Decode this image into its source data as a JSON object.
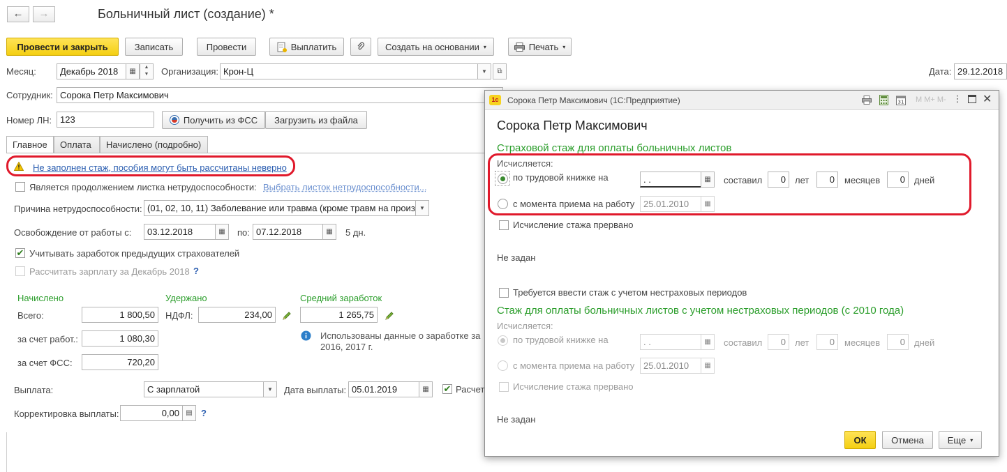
{
  "header": {
    "back_icon": "arrow-left-icon",
    "forward_icon": "arrow-right-icon",
    "title": "Больничный лист (создание) *"
  },
  "toolbar": {
    "post_close": "Провести и закрыть",
    "save": "Записать",
    "post": "Провести",
    "pay": "Выплатить",
    "create_based": "Создать на основании",
    "print": "Печать"
  },
  "form": {
    "month_label": "Месяц:",
    "month_value": "Декабрь 2018",
    "org_label": "Организация:",
    "org_value": "Крон-Ц",
    "date_label": "Дата:",
    "date_value": "29.12.2018",
    "employee_label": "Сотрудник:",
    "employee_value": "Сорока Петр Максимович",
    "ln_label": "Номер ЛН:",
    "ln_value": "123",
    "get_fss": "Получить из ФСС",
    "load_file": "Загрузить из файла",
    "tabs": [
      "Главное",
      "Оплата",
      "Начислено (подробно)"
    ],
    "warning": "Не заполнен стаж, пособия могут быть рассчитаны неверно",
    "continuation_label": "Является продолжением листка нетрудоспособности:",
    "continuation_link": "Выбрать листок нетрудоспособности...",
    "reason_label": "Причина нетрудоспособности:",
    "reason_value": "(01, 02, 10, 11) Заболевание или травма (кроме травм на произв",
    "release_label": "Освобождение от работы с:",
    "release_from": "03.12.2018",
    "release_to_label": "по:",
    "release_to": "07.12.2018",
    "release_days": "5 дн.",
    "prev_insurers_label": "Учитывать заработок предыдущих страхователей",
    "calc_salary_label": "Рассчитать зарплату за Декабрь 2018",
    "help": "?",
    "accrued_header": "Начислено",
    "withheld_header": "Удержано",
    "avg_header": "Средний заработок",
    "total_label": "Всего:",
    "total_value": "1 800,50",
    "ndfl_label": "НДФЛ:",
    "ndfl_value": "234,00",
    "avg_value": "1 265,75",
    "employer_label": "за счет работ.:",
    "employer_value": "1 080,30",
    "fss_label": "за счет ФСС:",
    "fss_value": "720,20",
    "info_text_1": "Использованы данные о заработке за",
    "info_text_2": "2016,  2017 г.",
    "payment_label": "Выплата:",
    "payment_value": "С зарплатой",
    "pay_date_label": "Дата выплаты:",
    "pay_date_value": "05.01.2019",
    "calc_cut": "Расчет",
    "correction_label": "Корректировка выплаты:",
    "correction_value": "0,00"
  },
  "dialog": {
    "app_icon": "1c-logo-icon",
    "window_title": "Сорока Петр Максимович  (1С:Предприятие)",
    "heading": "Сорока Петр Максимович",
    "section1_title": "Страховой стаж для оплаты больничных листов",
    "computed_label": "Исчисляется:",
    "by_book_label": "по трудовой книжке на",
    "by_book_date": " .  .",
    "amounted_label": "составил",
    "years_value": "0",
    "years_label": "лет",
    "months_value": "0",
    "months_label": "месяцев",
    "days_value": "0",
    "days_label": "дней",
    "from_hire_label": "с момента приема на работу",
    "from_hire_date": "25.01.2010",
    "interrupted_label": "Исчисление стажа прервано",
    "not_set": "Не задан",
    "noninsurance_label": "Требуется ввести стаж с учетом нестраховых периодов",
    "section2_title": "Стаж для оплаты больничных листов с учетом нестраховых периодов (с 2010 года)",
    "ok": "ОК",
    "cancel": "Отмена",
    "more": "Еще",
    "titlebar_letters": "M  M+  M-"
  },
  "colors": {
    "accent_yellow": "#f4cf12",
    "green_heading": "#2a9d2a",
    "red_highlight": "#e0192b",
    "link": "#2a5db0"
  }
}
